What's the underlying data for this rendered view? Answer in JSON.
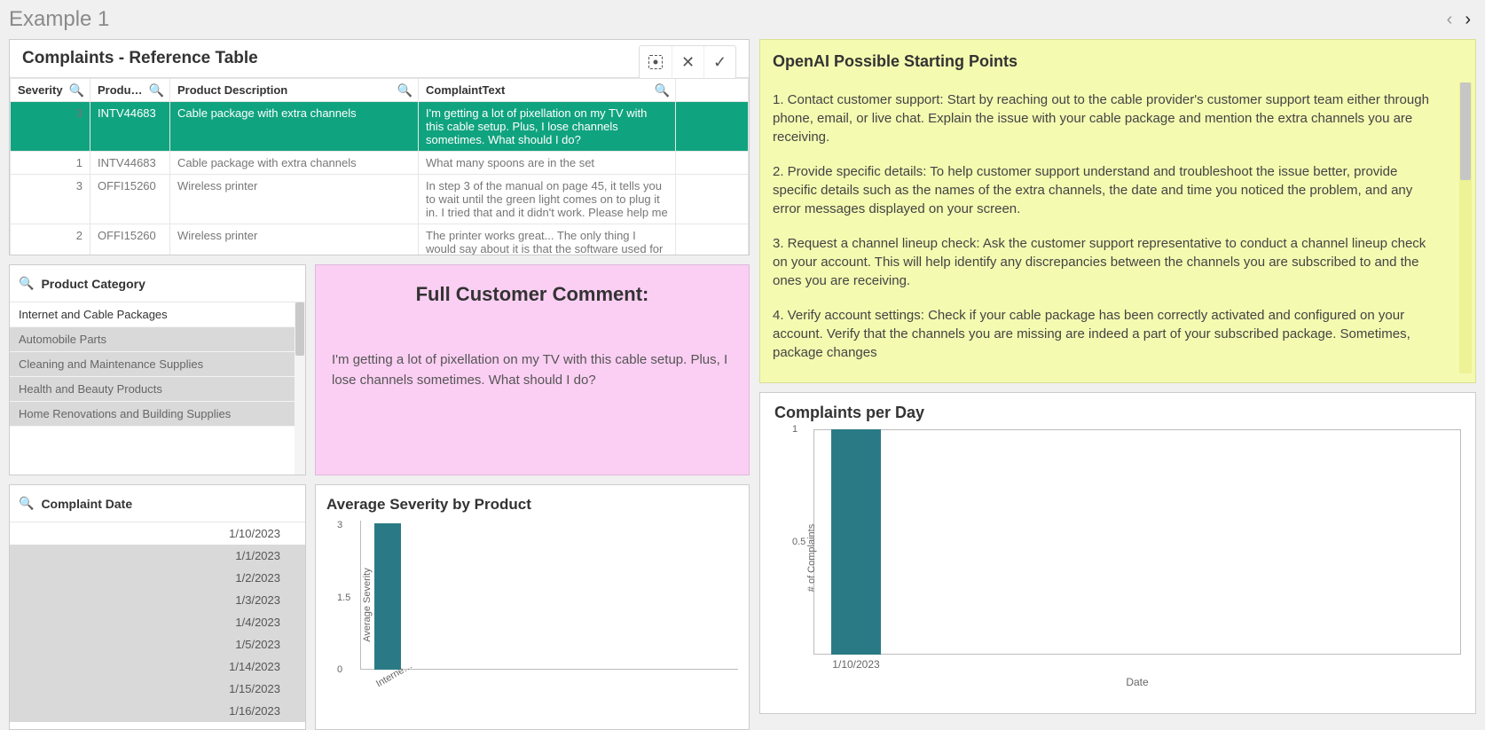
{
  "header": {
    "title": "Example 1"
  },
  "table": {
    "title": "Complaints - Reference Table",
    "columns": {
      "severity": "Severity",
      "product": "Produ…",
      "desc": "Product Description",
      "text": "ComplaintText"
    },
    "rows": [
      {
        "sev": "3",
        "prod": "INTV44683",
        "desc": "Cable package with extra channels",
        "text": "I'm getting a lot of pixellation on my TV with this cable setup. Plus, I lose channels sometimes. What should I do?",
        "selected": true
      },
      {
        "sev": "1",
        "prod": "INTV44683",
        "desc": "Cable package with extra channels",
        "text": "What many spoons are in the set"
      },
      {
        "sev": "3",
        "prod": "OFFI15260",
        "desc": "Wireless printer",
        "text": "In step 3 of the manual on page 45, it tells you to wait until the green light comes on to plug it in. I tried that and it didn't work. Please help me"
      },
      {
        "sev": "2",
        "prod": "OFFI15260",
        "desc": "Wireless printer",
        "text": "The printer works great... The only thing I would say about it is that the software used for it does"
      }
    ]
  },
  "categories": {
    "title": "Product Category",
    "items": [
      "Internet and Cable Packages",
      "Automobile Parts",
      "Cleaning and Maintenance Supplies",
      "Health and Beauty Products",
      "Home Renovations and Building Supplies"
    ],
    "active_index": 0
  },
  "dates": {
    "title": "Complaint Date",
    "items": [
      "1/10/2023",
      "1/1/2023",
      "1/2/2023",
      "1/3/2023",
      "1/4/2023",
      "1/5/2023",
      "1/14/2023",
      "1/15/2023",
      "1/16/2023"
    ],
    "active_index": 0
  },
  "comment": {
    "title": "Full Customer Comment:",
    "body": "I'm getting a lot of pixellation on my TV with this cable setup. Plus, I lose channels sometimes. What should I do?"
  },
  "ai": {
    "title": "OpenAI Possible Starting Points",
    "paragraphs": [
      "1. Contact customer support: Start by reaching out to the cable provider's customer support team either through phone, email, or live chat. Explain the issue with your cable package and mention the extra channels you are receiving.",
      "2. Provide specific details: To help customer support understand and troubleshoot the issue better, provide specific details such as the names of the extra channels, the date and time you noticed the problem, and any error messages displayed on your screen.",
      "3. Request a channel lineup check: Ask the customer support representative to conduct a channel lineup check on your account. This will help identify any discrepancies between the channels you are subscribed to and the ones you are receiving.",
      "4. Verify account settings: Check if your cable package has been correctly activated and configured on your account. Verify that the channels you are missing are indeed a part of your subscribed package. Sometimes, package changes"
    ]
  },
  "chart_data": [
    {
      "id": "avg_severity",
      "type": "bar",
      "title": "Average Severity by Product",
      "categories": [
        "Interne…"
      ],
      "values": [
        3.05
      ],
      "ylabel": "Average Severity",
      "yticks": [
        0,
        1.5,
        3
      ],
      "ylim": [
        0,
        3.1
      ]
    },
    {
      "id": "complaints_per_day",
      "type": "bar",
      "title": "Complaints per Day",
      "categories": [
        "1/10/2023"
      ],
      "values": [
        1
      ],
      "ylabel": "# of Complaints",
      "xlabel": "Date",
      "yticks": [
        0.5,
        1
      ],
      "ylim": [
        0,
        1
      ]
    }
  ]
}
